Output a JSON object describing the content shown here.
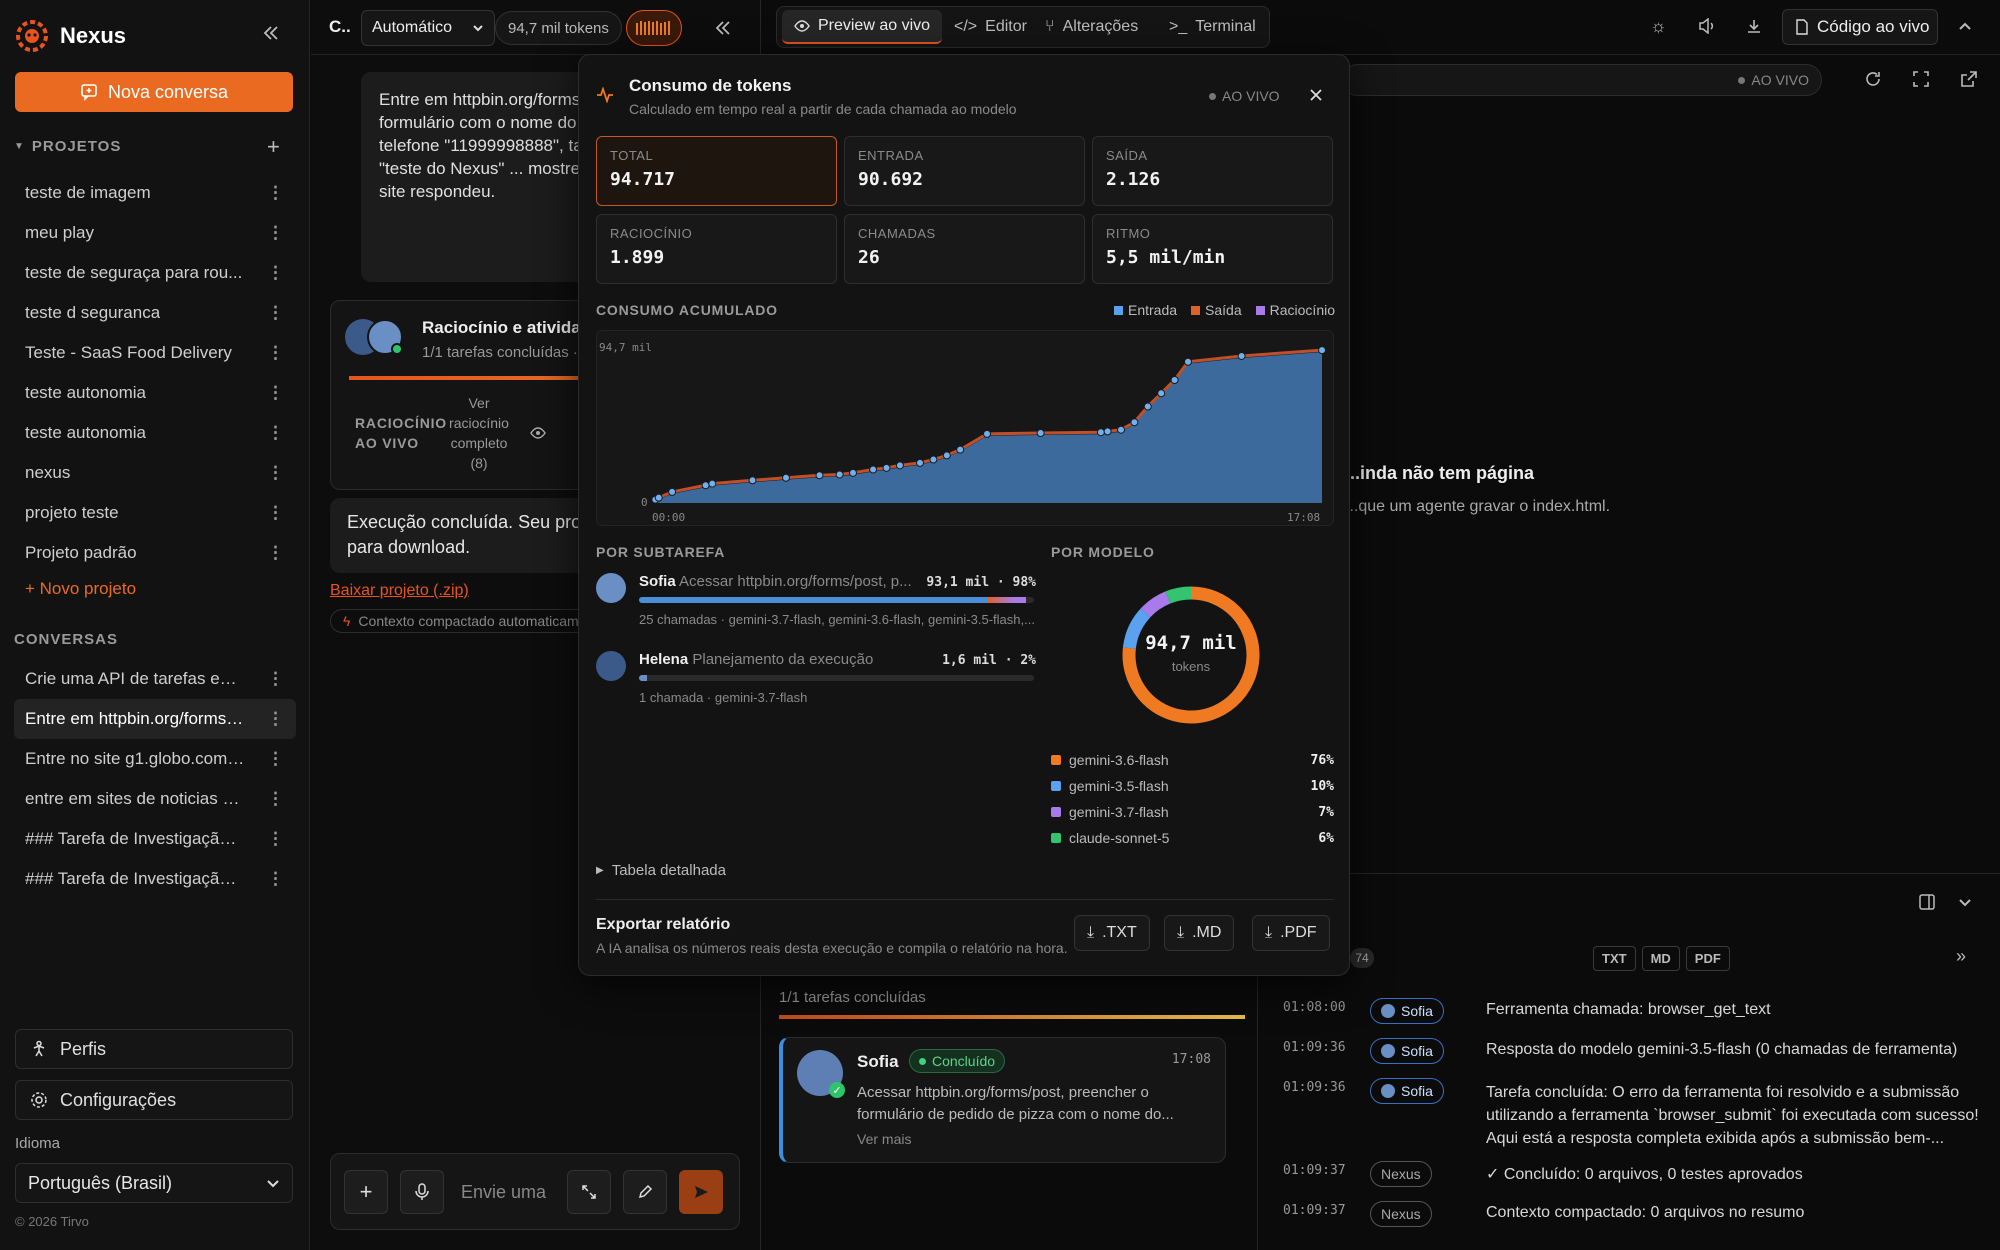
{
  "sidebar": {
    "brand": "Nexus",
    "new_chat": "Nova conversa",
    "projects_title": "PROJETOS",
    "projects": [
      "teste de imagem",
      "meu play",
      "teste de seguraça para rou...",
      "teste d seguranca",
      "Teste - SaaS Food Delivery",
      "teste autonomia",
      "teste autonomia",
      "nexus",
      "projeto teste",
      "Projeto padrão"
    ],
    "new_project": "+ Novo projeto",
    "conversations_title": "CONVERSAS",
    "conversations": [
      "Crie uma API de tarefas em...",
      "Entre em httpbin.org/forms/...",
      "Entre no site g1.globo.com, ...",
      "entre em sites de noticias cl...",
      "### Tarefa de Investigação ...",
      "### Tarefa de Investigação ..."
    ],
    "profiles": "Perfis",
    "settings": "Configurações",
    "language_label": "Idioma",
    "language_value": "Português (Brasil)",
    "copyright": "© 2026 Tirvo"
  },
  "chat": {
    "title": "C..",
    "mode": "Automático",
    "tokens": "94,7 mil tokens",
    "bubble_text": "Entre em httpbin.org/forms/post, preencha o formulário com o nome do cliente \"Edu Lima\", telefone \"11999998888\", tamanho ... comentário \"teste do Nexus\" ... mostre exatamente o que o site respondeu.",
    "activity_title": "Raciocínio e atividade",
    "activity_sub": "1/1 tarefas concluídas ·",
    "live_reasoning": "RACIOCÍNIO AO VIVO",
    "see_reasoning": "Ver raciocínio completo (8)",
    "done_text": "Execução concluída. Seu projeto está pronto para download.",
    "download_link": "Baixar projeto (.zip)",
    "compacted": "Contexto compactado automaticamente",
    "input_placeholder": "Envie uma"
  },
  "preview": {
    "tabs": [
      "Preview ao vivo",
      "Editor",
      "Alterações",
      "Terminal"
    ],
    "live_code": "Código ao vivo",
    "live_badge": "AO VIVO",
    "empty_title": "...inda não tem página",
    "empty_sub": "...que um agente gravar o index.html.",
    "tasks_done": "1/1 tarefas concluídas",
    "task_agent": "Sofia",
    "task_status": "Concluído",
    "task_time": "17:08",
    "task_text": "Acessar httpbin.org/forms/post, preencher o formulário de pedido de pizza com o nome do...",
    "see_more": "Ver mais",
    "log_count": "74",
    "log_exports": [
      "TXT",
      "MD",
      "PDF"
    ],
    "log": [
      {
        "time": "01:08:00",
        "who": "Sofia",
        "msg": "Ferramenta chamada: browser_get_text"
      },
      {
        "time": "01:09:36",
        "who": "Sofia",
        "msg": "Resposta do modelo gemini-3.5-flash (0 chamadas de ferramenta)"
      },
      {
        "time": "01:09:36",
        "who": "Sofia",
        "msg": "Tarefa concluída: O erro da ferramenta foi resolvido e a submissão utilizando a ferramenta `browser_submit` foi executada com sucesso! Aqui está a resposta completa exibida após a submissão bem-..."
      },
      {
        "time": "01:09:37",
        "who": "Nexus",
        "msg": "✓ Concluído: 0 arquivos, 0 testes aprovados"
      },
      {
        "time": "01:09:37",
        "who": "Nexus",
        "msg": "Contexto compactado: 0 arquivos no resumo"
      }
    ]
  },
  "modal": {
    "title": "Consumo de tokens",
    "subtitle": "Calculado em tempo real a partir de cada chamada ao modelo",
    "live": "AO VIVO",
    "stats": [
      {
        "label": "TOTAL",
        "value": "94.717"
      },
      {
        "label": "ENTRADA",
        "value": "90.692"
      },
      {
        "label": "SAÍDA",
        "value": "2.126"
      },
      {
        "label": "RACIOCÍNIO",
        "value": "1.899"
      },
      {
        "label": "CHAMADAS",
        "value": "26"
      },
      {
        "label": "RITMO",
        "value": "5,5 mil/min"
      }
    ],
    "accum_title": "CONSUMO ACUMULADO",
    "legend": [
      "Entrada",
      "Saída",
      "Raciocínio"
    ],
    "by_subtask_title": "POR SUBTAREFA",
    "subtasks": [
      {
        "name": "Sofia",
        "task": "Acessar httpbin.org/forms/post, p...",
        "value": "93,1 mil · 98%",
        "meta": "25 chamadas · gemini-3.7-flash, gemini-3.6-flash, gemini-3.5-flash,...",
        "pct": 98
      },
      {
        "name": "Helena",
        "task": "Planejamento da execução",
        "value": "1,6 mil · 2%",
        "meta": "1 chamada · gemini-3.7-flash",
        "pct": 2
      }
    ],
    "by_model_title": "POR MODELO",
    "donut_value": "94,7 mil",
    "donut_unit": "tokens",
    "models": [
      {
        "name": "gemini-3.6-flash",
        "pct": "76%",
        "color": "#f07a22",
        "frac": 0.76
      },
      {
        "name": "gemini-3.5-flash",
        "pct": "10%",
        "color": "#5aa2f0",
        "frac": 0.1
      },
      {
        "name": "gemini-3.7-flash",
        "pct": "7%",
        "color": "#a87bea",
        "frac": 0.07
      },
      {
        "name": "claude-sonnet-5",
        "pct": "6%",
        "color": "#34c36f",
        "frac": 0.06
      }
    ],
    "detail_table": "Tabela detalhada",
    "export_title": "Exportar relatório",
    "export_sub": "A IA analisa os números reais desta execução e compila o relatório na hora.",
    "export_buttons": [
      ".TXT",
      ".MD",
      ".PDF"
    ]
  },
  "chart_data": {
    "type": "area",
    "title": "CONSUMO ACUMULADO",
    "xlabel": "",
    "ylabel": "",
    "x_ticks": [
      "00:00",
      "17:08"
    ],
    "y_ticks": [
      "0",
      "94,7 mil"
    ],
    "ylim": [
      0,
      94717
    ],
    "legend_position": "top-right",
    "series": [
      {
        "name": "Entrada",
        "color": "#4a8fd8",
        "values": [
          800,
          2000,
          5500,
          9500,
          10500,
          12500,
          14000,
          15500,
          16000,
          17000,
          19000,
          20000,
          21500,
          23000,
          25000,
          27500,
          31000,
          40500,
          41000,
          41500,
          42000,
          43000,
          47500,
          57000,
          65000,
          73000,
          84000,
          87500,
          91000
        ]
      },
      {
        "name": "Saída",
        "color": "#e0602a"
      },
      {
        "name": "Raciocínio",
        "color": "#a87bea"
      }
    ],
    "x": [
      0.5,
      1,
      3,
      8,
      9,
      15,
      20,
      25,
      28,
      30,
      33,
      35,
      37,
      40,
      42,
      44,
      46,
      50,
      58,
      67,
      68,
      70,
      72,
      74,
      76,
      78,
      80,
      88,
      100
    ]
  }
}
